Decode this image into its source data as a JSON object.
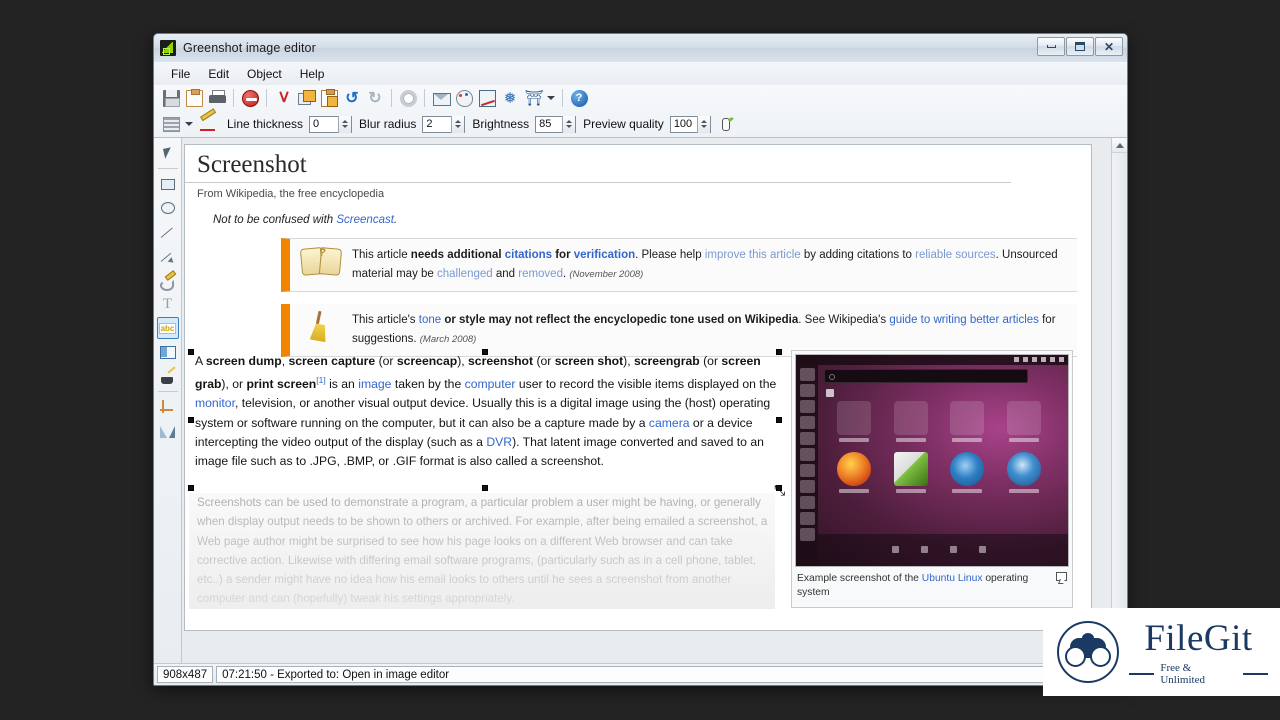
{
  "window": {
    "title": "Greenshot image editor",
    "app_icon": "greenshot-icon",
    "controls": {
      "minimize": "Minimize",
      "maximize": "Maximize",
      "close": "Close"
    }
  },
  "menubar": {
    "items": [
      "File",
      "Edit",
      "Object",
      "Help"
    ]
  },
  "toolbar_top": {
    "buttons": [
      {
        "name": "save-button",
        "icon": "save-icon",
        "label": "Save"
      },
      {
        "name": "copy-image-to-clipboard-button",
        "icon": "clipboard-icon",
        "label": "Copy image to clipboard"
      },
      {
        "name": "print-button",
        "icon": "printer-icon",
        "label": "Print"
      },
      {
        "name": "delete-button",
        "icon": "delete-icon",
        "label": "Delete"
      },
      {
        "name": "cut-button",
        "icon": "scissors-icon",
        "label": "Cut"
      },
      {
        "name": "copy-button",
        "icon": "copy-icon",
        "label": "Copy"
      },
      {
        "name": "paste-button",
        "icon": "paste-icon",
        "label": "Paste"
      },
      {
        "name": "undo-button",
        "icon": "undo-icon",
        "label": "Undo"
      },
      {
        "name": "redo-button",
        "icon": "redo-icon",
        "label": "Redo"
      },
      {
        "name": "settings-button",
        "icon": "gear-icon",
        "label": "Settings"
      },
      {
        "name": "export-button",
        "icon": "export-icon",
        "label": "Export"
      },
      {
        "name": "palette-button",
        "icon": "palette-icon",
        "label": "Color palette"
      },
      {
        "name": "obfuscate-button",
        "icon": "edit-image-icon",
        "label": "Obfuscate"
      },
      {
        "name": "effects-button",
        "icon": "effects-icon",
        "label": "Effects"
      },
      {
        "name": "torii-button",
        "icon": "torii-icon",
        "label": "Destination"
      },
      {
        "name": "help-button",
        "icon": "help-icon",
        "label": "Help"
      }
    ]
  },
  "toolbar_props": {
    "fill_label": "",
    "line_thickness": {
      "label": "Line thickness",
      "value": "0"
    },
    "blur_radius": {
      "label": "Blur radius",
      "value": "2"
    },
    "brightness": {
      "label": "Brightness",
      "value": "85"
    },
    "preview_quality": {
      "label": "Preview quality",
      "value": "100"
    }
  },
  "toolstrip": {
    "items": [
      {
        "name": "tool-select",
        "icon": "cursor-icon",
        "label": "Select",
        "active": false
      },
      {
        "name": "tool-rectangle",
        "icon": "rectangle-icon",
        "label": "Draw rectangle",
        "active": false
      },
      {
        "name": "tool-ellipse",
        "icon": "ellipse-icon",
        "label": "Draw ellipse",
        "active": false
      },
      {
        "name": "tool-line",
        "icon": "line-icon",
        "label": "Draw line",
        "active": false
      },
      {
        "name": "tool-arrow",
        "icon": "arrow-icon",
        "label": "Draw arrow",
        "active": false
      },
      {
        "name": "tool-freehand",
        "icon": "freehand-icon",
        "label": "Draw freehand",
        "active": false
      },
      {
        "name": "tool-text",
        "icon": "text-icon",
        "label": "Add textbox",
        "active": false
      },
      {
        "name": "tool-speech-bubble",
        "icon": "speech-bubble-icon",
        "label": "Add speech bubble",
        "active": false
      },
      {
        "name": "tool-counter",
        "icon": "abc-highlight-icon",
        "label": "Highlight",
        "active": true
      },
      {
        "name": "tool-highlight",
        "icon": "highlight-area-icon",
        "label": "Highlight area",
        "active": false
      },
      {
        "name": "tool-obfuscate",
        "icon": "magic-wand-icon",
        "label": "Obfuscate",
        "active": false
      },
      {
        "name": "tool-crop",
        "icon": "crop-icon",
        "label": "Crop",
        "active": false
      },
      {
        "name": "tool-rotate",
        "icon": "rotate-icon",
        "label": "Rotate",
        "active": false
      }
    ]
  },
  "canvas": {
    "size_label": "908x487",
    "article": {
      "title": "Screenshot",
      "subtitle": "From Wikipedia, the free encyclopedia",
      "hatnote_prefix": "Not to be confused with ",
      "hatnote_link": "Screencast",
      "hatnote_suffix": ".",
      "notices": [
        {
          "icon": "open-book-icon",
          "date": "(November 2008)",
          "segments": [
            {
              "text": "This article ",
              "style": "plain"
            },
            {
              "text": "needs additional ",
              "style": "bold"
            },
            {
              "text": "citations",
              "style": "link-bold"
            },
            {
              "text": " for ",
              "style": "bold"
            },
            {
              "text": "verification",
              "style": "link-bold"
            },
            {
              "text": ". Please help ",
              "style": "plain"
            },
            {
              "text": "improve this article",
              "style": "link-dim"
            },
            {
              "text": " by adding citations to ",
              "style": "plain"
            },
            {
              "text": "reliable sources",
              "style": "link-dim"
            },
            {
              "text": ". Unsourced material may be ",
              "style": "plain"
            },
            {
              "text": "challenged",
              "style": "link-dim"
            },
            {
              "text": " and ",
              "style": "plain"
            },
            {
              "text": "removed",
              "style": "link-dim"
            },
            {
              "text": ". ",
              "style": "plain"
            }
          ]
        },
        {
          "icon": "broom-icon",
          "date": "(March 2008)",
          "segments": [
            {
              "text": "This article's ",
              "style": "plain"
            },
            {
              "text": "tone",
              "style": "link"
            },
            {
              "text": " or style may not reflect the encyclopedic tone used on Wikipedia",
              "style": "bold"
            },
            {
              "text": ". See Wikipedia's ",
              "style": "plain"
            },
            {
              "text": "guide to writing better articles",
              "style": "link"
            },
            {
              "text": " for suggestions. ",
              "style": "plain"
            }
          ]
        }
      ],
      "paragraph1_segments": [
        {
          "text": "A ",
          "style": "plain"
        },
        {
          "text": "screen dump",
          "style": "bold"
        },
        {
          "text": ", ",
          "style": "plain"
        },
        {
          "text": "screen capture",
          "style": "bold"
        },
        {
          "text": " (or ",
          "style": "plain"
        },
        {
          "text": "screencap",
          "style": "bold"
        },
        {
          "text": "), ",
          "style": "plain"
        },
        {
          "text": "screenshot",
          "style": "bold"
        },
        {
          "text": " (or ",
          "style": "plain"
        },
        {
          "text": "screen shot",
          "style": "bold"
        },
        {
          "text": "), ",
          "style": "plain"
        },
        {
          "text": "screengrab",
          "style": "bold"
        },
        {
          "text": " (or ",
          "style": "plain"
        },
        {
          "text": "screen grab",
          "style": "bold"
        },
        {
          "text": "), or ",
          "style": "plain"
        },
        {
          "text": "print screen",
          "style": "bold"
        },
        {
          "text": "[1]",
          "style": "sup-link"
        },
        {
          "text": " is an ",
          "style": "plain"
        },
        {
          "text": "image",
          "style": "link"
        },
        {
          "text": " taken by the ",
          "style": "plain"
        },
        {
          "text": "computer",
          "style": "link"
        },
        {
          "text": " user to record the visible items displayed on the ",
          "style": "plain"
        },
        {
          "text": "monitor",
          "style": "link"
        },
        {
          "text": ", television, or another visual output device. Usually this is a digital image using the (host) operating system or software running on the computer, but it can also be a capture made by a ",
          "style": "plain"
        },
        {
          "text": "camera",
          "style": "link"
        },
        {
          "text": " or a device intercepting the video output of the display (such as a ",
          "style": "plain"
        },
        {
          "text": "DVR",
          "style": "link"
        },
        {
          "text": "). That latent image converted and saved to an image file such as to .JPG, .BMP, or .GIF format is also called a screenshot.",
          "style": "plain"
        }
      ],
      "paragraph2": "Screenshots can be used to demonstrate a program, a particular problem a user might be having, or generally when display output needs to be shown to others or archived. For example, after being emailed a screenshot, a Web page author might be surprised to see how his page looks on a different Web browser and can take corrective action. Likewise with differing email software programs, (particularly such as in a cell phone, tablet, etc..) a sender might have no idea how his email looks to others until he sees a screenshot from another computer and can (hopefully) tweak his settings appropriately.",
      "thumbnail": {
        "caption_prefix": "Example screenshot of the ",
        "caption_link": "Ubuntu Linux",
        "caption_suffix": " operating system",
        "enlarge_icon": "enlarge-icon",
        "desktop": {
          "search_placeholder": "",
          "category_label": "",
          "apps_row1": [
            "",
            "",
            "",
            ""
          ],
          "apps_row2": [
            "",
            "",
            "",
            ""
          ]
        }
      }
    }
  },
  "statusbar": {
    "dimensions": "908x487",
    "message": "07:21:50 - Exported to: Open in image editor"
  },
  "watermark": {
    "name": "FileGit",
    "tagline": "Free & Unlimited",
    "icon": "binoculars-icon"
  },
  "artifact_text": "",
  "colors": {
    "accent": "#3366cc",
    "notice_bar": "#f28500",
    "brand": "#1b3a63",
    "title_bar_start": "#e7eef5"
  }
}
